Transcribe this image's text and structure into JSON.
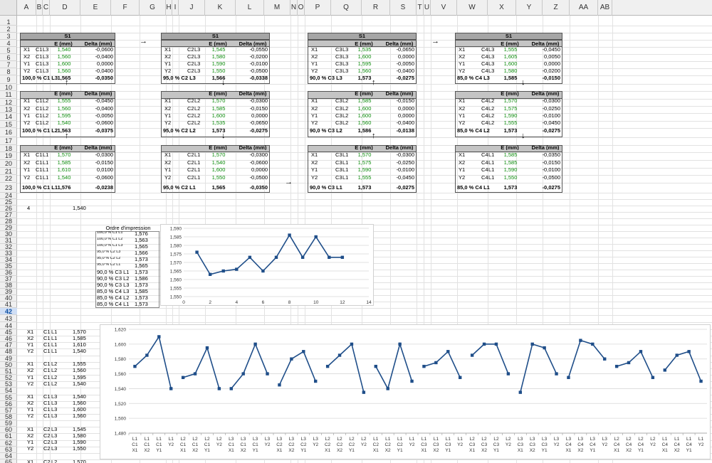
{
  "columns": [
    "A",
    "B",
    "C",
    "D",
    "E",
    "F",
    "G",
    "H",
    "I",
    "J",
    "K",
    "L",
    "M",
    "N",
    "O",
    "P",
    "Q",
    "R",
    "S",
    "T",
    "U",
    "V",
    "W",
    "X",
    "Y",
    "Z",
    "AA",
    "AB"
  ],
  "rows": [
    "1",
    "2",
    "3",
    "4",
    "5",
    "6",
    "7",
    "8",
    "9",
    "10",
    "11",
    "12",
    "13",
    "14",
    "15",
    "16",
    "17",
    "18",
    "19",
    "20",
    "21",
    "22",
    "23",
    "24",
    "25",
    "26",
    "27",
    "28",
    "29",
    "30",
    "31",
    "32",
    "33",
    "34",
    "35",
    "36",
    "37",
    "38",
    "39",
    "40",
    "41",
    "42",
    "43",
    "44",
    "45",
    "46",
    "47",
    "48",
    "49",
    "50",
    "51",
    "52",
    "53",
    "54",
    "55",
    "56",
    "57",
    "58",
    "59",
    "60",
    "61",
    "62",
    "63",
    "64",
    "65"
  ],
  "selected_row": "42",
  "header_labels": {
    "s1": "S1",
    "e": "E (mm)",
    "delta": "Delta (mm)"
  },
  "arrows": {
    "right": "→",
    "down": "↓",
    "up": "↑"
  },
  "tables": [
    {
      "rows": [
        [
          "X1",
          "C1",
          "L3",
          "1,540",
          "-0,0600"
        ],
        [
          "X2",
          "C1",
          "L3",
          "1,560",
          "-0,0400"
        ],
        [
          "Y1",
          "C1",
          "L3",
          "1,600",
          "0,0000"
        ],
        [
          "Y2",
          "C1",
          "L3",
          "1,560",
          "-0,0400"
        ]
      ],
      "summary_label": "100,0 % C1 L3",
      "summary_e": "1,565",
      "summary_d": "-0,0350"
    },
    {
      "rows": [
        [
          "X1",
          "C2",
          "L3",
          "1,545",
          "-0,0550"
        ],
        [
          "X2",
          "C2",
          "L3",
          "1,580",
          "-0,0200"
        ],
        [
          "Y1",
          "C2",
          "L3",
          "1,590",
          "-0,0100"
        ],
        [
          "Y2",
          "C2",
          "L3",
          "1,550",
          "-0,0500"
        ]
      ],
      "summary_label": "95,0 % C2 L3",
      "summary_e": "1,566",
      "summary_d": "-0,0338"
    },
    {
      "rows": [
        [
          "X1",
          "C3",
          "L3",
          "1,535",
          "-0,0650"
        ],
        [
          "X2",
          "C3",
          "L3",
          "1,600",
          "0,0000"
        ],
        [
          "Y1",
          "C3",
          "L3",
          "1,595",
          "-0,0050"
        ],
        [
          "Y2",
          "C3",
          "L3",
          "1,560",
          "-0,0400"
        ]
      ],
      "summary_label": "90,0 % C3 L3",
      "summary_e": "1,573",
      "summary_d": "-0,0275"
    },
    {
      "rows": [
        [
          "X1",
          "C4",
          "L3",
          "1,555",
          "-0,0450"
        ],
        [
          "X2",
          "C4",
          "L3",
          "1,605",
          "0,0050"
        ],
        [
          "Y1",
          "C4",
          "L3",
          "1,600",
          "0,0000"
        ],
        [
          "Y2",
          "C4",
          "L3",
          "1,580",
          "-0,0200"
        ]
      ],
      "summary_label": "85,0 % C4 L3",
      "summary_e": "1,585",
      "summary_d": "-0,0150"
    },
    {
      "rows": [
        [
          "X1",
          "C1",
          "L2",
          "1,555",
          "-0,0450"
        ],
        [
          "X2",
          "C1",
          "L2",
          "1,560",
          "-0,0400"
        ],
        [
          "Y1",
          "C1",
          "L2",
          "1,595",
          "-0,0050"
        ],
        [
          "Y2",
          "C1",
          "L2",
          "1,540",
          "-0,0600"
        ]
      ],
      "summary_label": "100,0 % C1 L2",
      "summary_e": "1,563",
      "summary_d": "-0,0375"
    },
    {
      "rows": [
        [
          "X1",
          "C2",
          "L2",
          "1,570",
          "-0,0300"
        ],
        [
          "X2",
          "C2",
          "L2",
          "1,585",
          "-0,0150"
        ],
        [
          "Y1",
          "C2",
          "L2",
          "1,600",
          "0,0000"
        ],
        [
          "Y2",
          "C2",
          "L2",
          "1,535",
          "-0,0650"
        ]
      ],
      "summary_label": "95,0 % C2 L2",
      "summary_e": "1,573",
      "summary_d": "-0,0275"
    },
    {
      "rows": [
        [
          "X1",
          "C3",
          "L2",
          "1,585",
          "-0,0150"
        ],
        [
          "X2",
          "C3",
          "L2",
          "1,600",
          "0,0000"
        ],
        [
          "Y1",
          "C3",
          "L2",
          "1,600",
          "0,0000"
        ],
        [
          "Y2",
          "C3",
          "L2",
          "1,560",
          "-0,0400"
        ]
      ],
      "summary_label": "90,0 % C3 L2",
      "summary_e": "1,586",
      "summary_d": "-0,0138"
    },
    {
      "rows": [
        [
          "X1",
          "C4",
          "L2",
          "1,570",
          "-0,0300"
        ],
        [
          "X2",
          "C4",
          "L2",
          "1,575",
          "-0,0250"
        ],
        [
          "Y1",
          "C4",
          "L2",
          "1,590",
          "-0,0100"
        ],
        [
          "Y2",
          "C4",
          "L2",
          "1,555",
          "-0,0450"
        ]
      ],
      "summary_label": "85,0 % C4 L2",
      "summary_e": "1,573",
      "summary_d": "-0,0275"
    },
    {
      "rows": [
        [
          "X1",
          "C1",
          "L1",
          "1,570",
          "-0,0300"
        ],
        [
          "X2",
          "C1",
          "L1",
          "1,585",
          "-0,0150"
        ],
        [
          "Y1",
          "C1",
          "L1",
          "1,610",
          "0,0100"
        ],
        [
          "Y2",
          "C1",
          "L1",
          "1,540",
          "-0,0600"
        ]
      ],
      "summary_label": "100,0 % C1 L1",
      "summary_e": "1,576",
      "summary_d": "-0,0238"
    },
    {
      "rows": [
        [
          "X1",
          "C2",
          "L1",
          "1,570",
          "-0,0300"
        ],
        [
          "X2",
          "C2",
          "L1",
          "1,540",
          "-0,0600"
        ],
        [
          "Y1",
          "C2",
          "L1",
          "1,600",
          "0,0000"
        ],
        [
          "Y2",
          "C2",
          "L1",
          "1,550",
          "-0,0500"
        ]
      ],
      "summary_label": "95,0 % C2 L1",
      "summary_e": "1,565",
      "summary_d": "-0,0350"
    },
    {
      "rows": [
        [
          "X1",
          "C3",
          "L1",
          "1,570",
          "-0,0300"
        ],
        [
          "X2",
          "C3",
          "L1",
          "1,575",
          "-0,0250"
        ],
        [
          "Y1",
          "C3",
          "L1",
          "1,590",
          "-0,0100"
        ],
        [
          "Y2",
          "C3",
          "L1",
          "1,555",
          "-0,0450"
        ]
      ],
      "summary_label": "90,0 % C3 L1",
      "summary_e": "1,573",
      "summary_d": "-0,0275"
    },
    {
      "rows": [
        [
          "X1",
          "C4",
          "L1",
          "1,585",
          "-0,0350"
        ],
        [
          "X2",
          "C4",
          "L1",
          "1,585",
          "-0,0150"
        ],
        [
          "Y1",
          "C4",
          "L1",
          "1,590",
          "-0,0100"
        ],
        [
          "Y2",
          "C4",
          "L1",
          "1,550",
          "-0,0500"
        ]
      ],
      "summary_label": "85,0 % C4 L1",
      "summary_e": "1,573",
      "summary_d": "-0,0275"
    }
  ],
  "row26": {
    "a": "4",
    "d": "1,540"
  },
  "print_order": {
    "title": "Ordre d'impression",
    "rows": [
      [
        "100,0 % C1 L1",
        "1,576"
      ],
      [
        "100,0 % C1 L2",
        "1,563"
      ],
      [
        "100,0 % C1 L3",
        "1,565"
      ],
      [
        "95,0 % C2 L3",
        "1,566"
      ],
      [
        "95,0 % C2 L2",
        "1,573"
      ],
      [
        "95,0 % C2 L1",
        "1,565"
      ],
      [
        "90,0 % C3 L1",
        "1,573"
      ],
      [
        "90,0 % C3 L2",
        "1,586"
      ],
      [
        "90,0 % C3 L3",
        "1,573"
      ],
      [
        "85,0 % C4 L3",
        "1,585"
      ],
      [
        "85,0 % C4 L2",
        "1,573"
      ],
      [
        "85,0 % C4 L1",
        "1,573"
      ]
    ]
  },
  "bottom_list": [
    [
      "X1",
      "C1",
      "L1",
      "1,570"
    ],
    [
      "X2",
      "C1",
      "L1",
      "1,585"
    ],
    [
      "Y1",
      "C1",
      "L1",
      "1,610"
    ],
    [
      "Y2",
      "C1",
      "L1",
      "1,540"
    ],
    [],
    [
      "X1",
      "C1",
      "L2",
      "1,555"
    ],
    [
      "X2",
      "C1",
      "L2",
      "1,560"
    ],
    [
      "Y1",
      "C1",
      "L2",
      "1,595"
    ],
    [
      "Y2",
      "C1",
      "L2",
      "1,540"
    ],
    [],
    [
      "X1",
      "C1",
      "L3",
      "1,540"
    ],
    [
      "X2",
      "C1",
      "L3",
      "1,560"
    ],
    [
      "Y1",
      "C1",
      "L3",
      "1,600"
    ],
    [
      "Y2",
      "C1",
      "L3",
      "1,560"
    ],
    [],
    [
      "X1",
      "C2",
      "L3",
      "1,545"
    ],
    [
      "X2",
      "C2",
      "L3",
      "1,580"
    ],
    [
      "Y1",
      "C2",
      "L3",
      "1,590"
    ],
    [
      "Y2",
      "C2",
      "L3",
      "1,550"
    ],
    [],
    [
      "X1",
      "C2",
      "L2",
      "1,570"
    ]
  ],
  "chart_data": [
    {
      "type": "line",
      "x": [
        1,
        2,
        3,
        4,
        5,
        6,
        7,
        8,
        9,
        10,
        11,
        12
      ],
      "y": [
        1.576,
        1.563,
        1.565,
        1.566,
        1.573,
        1.565,
        1.573,
        1.586,
        1.573,
        1.585,
        1.573,
        1.573
      ],
      "xlim": [
        0,
        14
      ],
      "ylim": [
        1.55,
        1.59
      ],
      "xticks": [
        "0",
        "2",
        "4",
        "6",
        "8",
        "10",
        "12",
        "14"
      ],
      "yticks": [
        "1,550",
        "1,555",
        "1,560",
        "1,565",
        "1,570",
        "1,575",
        "1,580",
        "1,585",
        "1,590"
      ],
      "grid": true,
      "color": "#1f4e89"
    },
    {
      "type": "line",
      "categories": [
        "L1 C1 X1",
        "L1 C1 X2",
        "L1 C1 Y1",
        "L1 Y2",
        "L2 C1 X1",
        "L2 C1 X2",
        "L2 C1 Y1",
        "L2 Y2",
        "L3 C1 X1",
        "L3 C1 X2",
        "L3 C1 Y1",
        "L3 Y2",
        "L3 C2 X1",
        "L3 C2 X2",
        "L3 C2 Y1",
        "L3 Y2",
        "L2 C2 X1",
        "L2 C2 X2",
        "L2 C2 Y1",
        "L2 Y2",
        "L1 C2 X1",
        "L1 C2 X2",
        "L1 C2 Y1",
        "L1 Y2",
        "L1 C3 X1",
        "L1 C3 X2",
        "L1 C3 Y1",
        "L1 Y2",
        "L2 C3 X1",
        "L2 C3 X2",
        "L2 C3 Y1",
        "L2 Y2",
        "L3 C3 X1",
        "L3 C3 X2",
        "L3 C3 Y1",
        "L3 Y2",
        "L3 C4 X1",
        "L3 C4 X2",
        "L3 C4 Y1",
        "L3 Y2",
        "L2 C4 X1",
        "L2 C4 X2",
        "L2 C4 Y1",
        "L2 Y2",
        "L1 C4 X1",
        "L1 C4 X2",
        "L1 C4 Y1",
        "L1 Y2"
      ],
      "segments": [
        [
          1.57,
          1.585,
          1.61,
          1.54
        ],
        [
          1.555,
          1.56,
          1.595,
          1.54
        ],
        [
          1.54,
          1.56,
          1.6,
          1.56
        ],
        [
          1.545,
          1.58,
          1.59,
          1.55
        ],
        [
          1.57,
          1.585,
          1.6,
          1.535
        ],
        [
          1.57,
          1.54,
          1.6,
          1.55
        ],
        [
          1.57,
          1.575,
          1.59,
          1.555
        ],
        [
          1.585,
          1.6,
          1.6,
          1.56
        ],
        [
          1.535,
          1.6,
          1.595,
          1.56
        ],
        [
          1.555,
          1.605,
          1.6,
          1.58
        ],
        [
          1.57,
          1.575,
          1.59,
          1.555
        ],
        [
          1.565,
          1.585,
          1.59,
          1.55
        ]
      ],
      "ylim": [
        1.48,
        1.62
      ],
      "yticks": [
        "1,480",
        "1,500",
        "1,520",
        "1,540",
        "1,560",
        "1,580",
        "1,600",
        "1,620"
      ],
      "grid": true,
      "color": "#1f4e89"
    }
  ]
}
